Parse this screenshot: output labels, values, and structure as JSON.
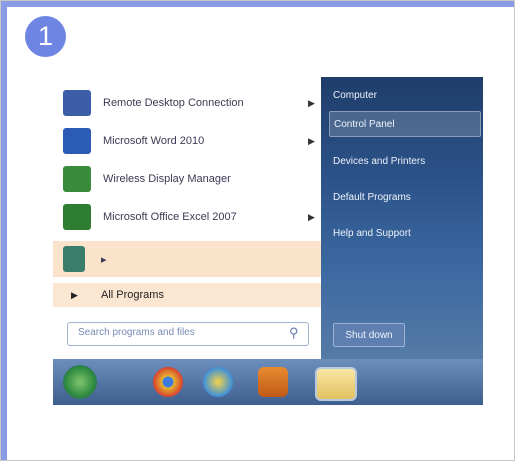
{
  "step": {
    "number": "1"
  },
  "start_menu": {
    "programs": [
      {
        "label": "Remote Desktop Connection",
        "has_submenu": true,
        "icon": "remote-desktop-icon",
        "color": "#3c5da8"
      },
      {
        "label": "Microsoft Word 2010",
        "has_submenu": true,
        "icon": "word-icon",
        "color": "#2b5bb5"
      },
      {
        "label": "Wireless Display Manager",
        "has_submenu": false,
        "icon": "wireless-display-icon",
        "color": "#3a8c3a"
      },
      {
        "label": "Microsoft Office Excel 2007",
        "has_submenu": true,
        "icon": "excel-icon",
        "color": "#2e7d32"
      },
      {
        "label": "",
        "has_submenu": true,
        "icon": "app-icon",
        "color": "#3a7d6a"
      }
    ],
    "all_programs": {
      "label": "All Programs"
    },
    "search": {
      "placeholder": "Search programs and files"
    },
    "right_items": [
      {
        "label": "Computer"
      },
      {
        "label": "Control Panel",
        "selected": true
      },
      {
        "label": "Devices and Printers"
      },
      {
        "label": "Default Programs"
      },
      {
        "label": "Help and Support"
      }
    ],
    "shutdown": {
      "label": "Shut down"
    }
  },
  "taskbar": {
    "items": [
      "start-orb-icon",
      "chrome-icon",
      "internet-explorer-icon",
      "media-player-icon",
      "folder-icon"
    ]
  },
  "colors": {
    "accent": "#6f85e3",
    "highlight": "#fbe3cb"
  }
}
